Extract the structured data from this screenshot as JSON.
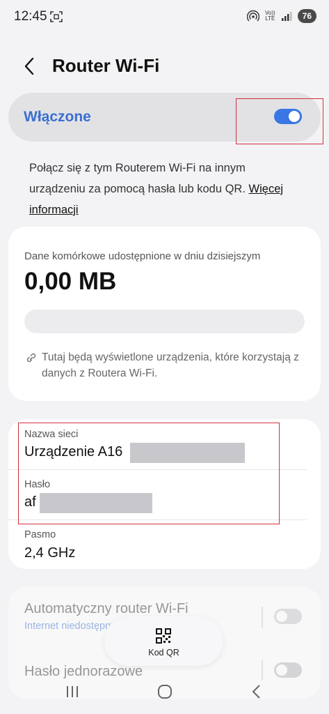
{
  "status_bar": {
    "time": "12:45",
    "network_lines": [
      "Vo))",
      "LTE"
    ],
    "battery": "76",
    "icons": [
      "screenshot-icon",
      "hotspot-icon",
      "volte-icon",
      "signal-icon",
      "battery-icon"
    ]
  },
  "header": {
    "title": "Router Wi-Fi",
    "back_icon": "back-arrow-icon"
  },
  "master_switch": {
    "label": "Włączone",
    "state": "on"
  },
  "description": {
    "text": "Połącz się z tym Routerem Wi-Fi na innym urządzeniu za pomocą hasła lub kodu QR.",
    "link": "Więcej informacji"
  },
  "usage_card": {
    "label": "Dane komórkowe udostępnione w dniu dzisiejszym",
    "value": "0,00 MB",
    "info": "Tutaj będą wyświetlone urządzenia, które korzystają z danych z Routera Wi-Fi."
  },
  "settings_card": {
    "network_name": {
      "label": "Nazwa sieci",
      "value": "Urządzenie A16"
    },
    "password": {
      "label": "Hasło",
      "value": "af"
    },
    "band": {
      "label": "Pasmo",
      "value": "2,4 GHz"
    }
  },
  "options_card": {
    "auto_router": {
      "title": "Automatyczny router Wi-Fi",
      "subtitle": "Internet niedostępny",
      "state": "off"
    },
    "one_time_password": {
      "title": "Hasło jednorazowe",
      "state": "off"
    }
  },
  "fab": {
    "label": "Kod QR",
    "icon": "qr-code-icon"
  },
  "nav_bar": {
    "buttons": [
      "recents-icon",
      "home-icon",
      "back-icon"
    ]
  },
  "colors": {
    "accent": "#3a77e4",
    "highlight": "#d32f3a",
    "background": "#f3f3f5"
  }
}
